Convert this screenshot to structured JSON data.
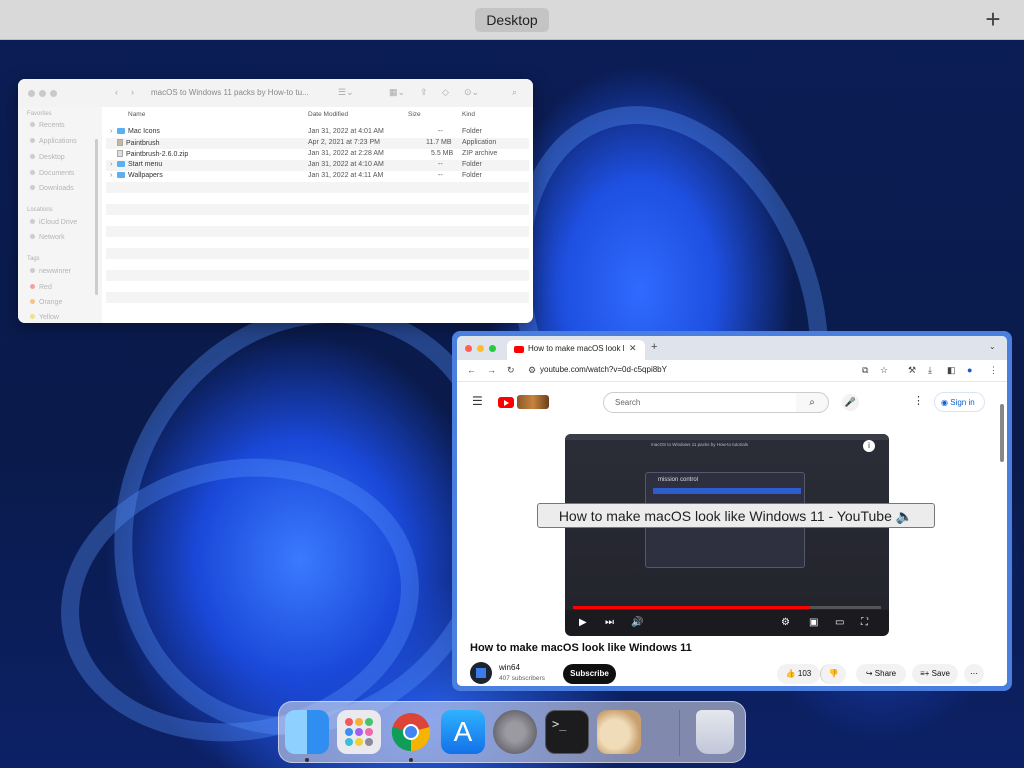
{
  "topbar": {
    "space_label": "Desktop",
    "add_label": "+"
  },
  "finder": {
    "title": "macOS to Windows 11 packs by How-to tu...",
    "sidebar": {
      "favorites_header": "Favorites",
      "favorites": [
        "Recents",
        "Applications",
        "Desktop",
        "Documents",
        "Downloads"
      ],
      "locations_header": "Locations",
      "locations": [
        "iCloud Drive",
        "Network"
      ],
      "tags_header": "Tags",
      "tags": [
        "newwinrer",
        "Red",
        "Orange",
        "Yellow"
      ]
    },
    "columns": {
      "name": "Name",
      "date": "Date Modified",
      "size": "Size",
      "kind": "Kind"
    },
    "rows": [
      {
        "name": "Mac Icons",
        "date": "Jan 31, 2022 at 4:01 AM",
        "size": "--",
        "kind": "Folder",
        "type": "folder"
      },
      {
        "name": "Paintbrush",
        "date": "Apr 2, 2021 at 7:23 PM",
        "size": "11.7 MB",
        "kind": "Application",
        "type": "app"
      },
      {
        "name": "Paintbrush-2.6.0.zip",
        "date": "Jan 31, 2022 at 2:28 AM",
        "size": "5.5 MB",
        "kind": "ZIP archive",
        "type": "file"
      },
      {
        "name": "Start menu",
        "date": "Jan 31, 2022 at 4:10 AM",
        "size": "--",
        "kind": "Folder",
        "type": "folder"
      },
      {
        "name": "Wallpapers",
        "date": "Jan 31, 2022 at 4:11 AM",
        "size": "--",
        "kind": "Folder",
        "type": "folder"
      }
    ]
  },
  "chrome": {
    "tab_title": "How to make macOS look like",
    "url": "youtube.com/watch?v=0d-c5qpi8bY",
    "youtube": {
      "search_placeholder": "Search",
      "signin_label": "Sign in",
      "tooltip": "How to make macOS look like Windows 11 - YouTube 🔈",
      "video_title": "How to make macOS look like Windows 11",
      "channel_name": "win64",
      "subscribers": "407 subscribers",
      "subscribe_label": "Subscribe",
      "like_count": "103",
      "share_label": "Share",
      "save_label": "Save",
      "video_window_title": "macOS to Windows 11 packs by How-to tutorials",
      "video_dialog_item": "mission control",
      "progress": 0.77
    }
  },
  "dock": {
    "apps": [
      "Finder",
      "Launchpad",
      "Google Chrome",
      "App Store",
      "System Preferences",
      "Terminal",
      "Paintbrush",
      "Trash"
    ],
    "running": [
      "Finder",
      "Google Chrome"
    ]
  },
  "colors": {
    "accent": "#4a7fe0",
    "youtube_red": "#ff0000",
    "folder": "#5ab0f0"
  }
}
